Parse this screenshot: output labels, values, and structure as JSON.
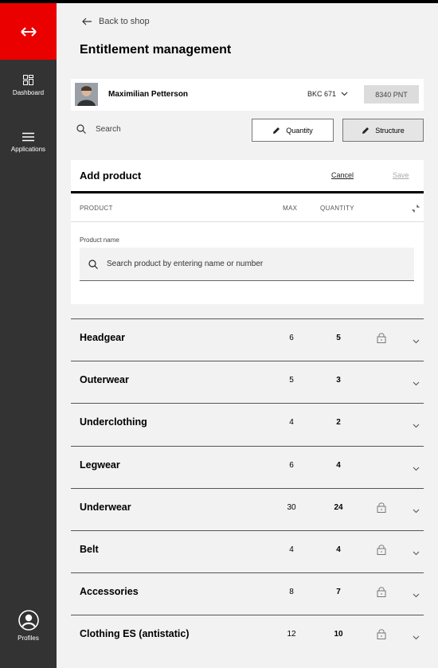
{
  "sidebar": {
    "logo_icon": "sbb-double-arrow-icon",
    "dashboard_label": "Dashboard",
    "applications_label": "Applications",
    "profiles_label": "Profiles"
  },
  "header": {
    "back_label": "Back to shop",
    "title": "Entitlement management"
  },
  "user": {
    "name": "Maximilian Petterson",
    "code": "BKC 671",
    "points": "8340 PNT"
  },
  "toolbar": {
    "search_placeholder": "Search",
    "quantity_label": "Quantity",
    "structure_label": "Structure"
  },
  "add_product": {
    "title": "Add product",
    "cancel_label": "Cancel",
    "save_label": "Save",
    "col_product": "PRODUCT",
    "col_max": "MAX",
    "col_quantity": "QUANTITY",
    "product_name_label": "Product name",
    "product_name_placeholder": "Search product by entering name or number"
  },
  "rows": [
    {
      "name": "Headgear",
      "max": "6",
      "quantity": "5",
      "locked": true
    },
    {
      "name": "Outerwear",
      "max": "5",
      "quantity": "3",
      "locked": false
    },
    {
      "name": "Underclothing",
      "max": "4",
      "quantity": "2",
      "locked": false
    },
    {
      "name": "Legwear",
      "max": "6",
      "quantity": "4",
      "locked": false
    },
    {
      "name": "Underwear",
      "max": "30",
      "quantity": "24",
      "locked": true
    },
    {
      "name": "Belt",
      "max": "4",
      "quantity": "4",
      "locked": true
    },
    {
      "name": "Accessories",
      "max": "8",
      "quantity": "7",
      "locked": true
    },
    {
      "name": "Clothing ES (antistatic)",
      "max": "12",
      "quantity": "10",
      "locked": true
    }
  ],
  "colors": {
    "brand_red": "#eb0000",
    "sidebar": "#333333",
    "background": "#f2f2f2"
  }
}
